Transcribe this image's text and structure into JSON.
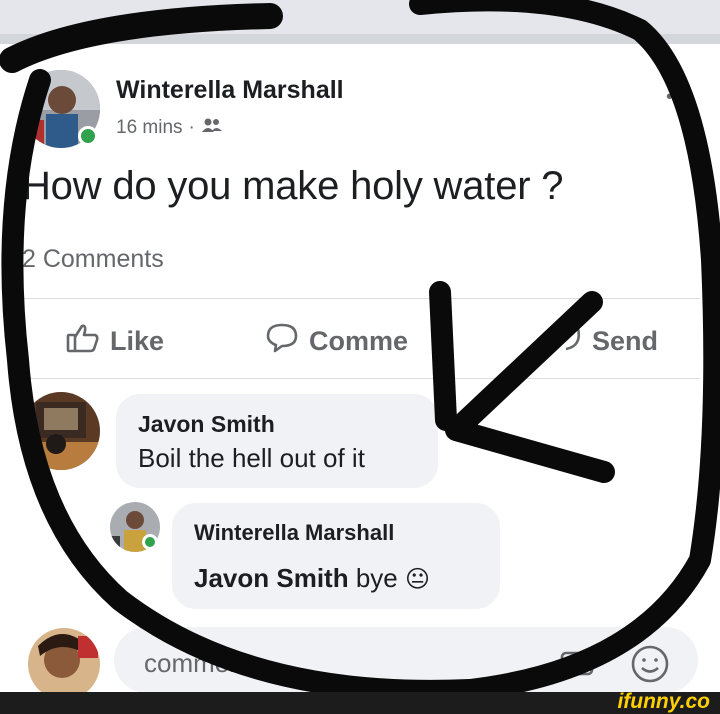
{
  "post": {
    "author": "Winterella Marshall",
    "time": "16 mins",
    "separator": "·",
    "audience_icon": "friends-icon",
    "more_icon": "more-dots-icon",
    "text": "How do you make holy water ?",
    "comments_count": "2 Comments"
  },
  "actions": [
    {
      "label": "Like",
      "icon": "thumbs-up-icon"
    },
    {
      "label": "Comment",
      "visible_label": "Comme",
      "icon": "comment-icon"
    },
    {
      "label": "Send",
      "icon": "send-icon"
    }
  ],
  "comments": [
    {
      "name": "Javon Smith",
      "text": "Boil the hell out of it"
    },
    {
      "name": "Winterella Marshall",
      "mention": "Javon Smith",
      "text": "bye",
      "emoji": "😐"
    }
  ],
  "composer": {
    "placeholder": "Write a comment...",
    "visible_placeholder": "comment...",
    "emoji_icon": "smiley-icon",
    "camera_icon": "camera-icon"
  },
  "watermark": "ifunny.co",
  "colors": {
    "accent_online": "#31a24c",
    "text_primary": "#1c1e21",
    "text_secondary": "#65676b",
    "bubble_bg": "#f0f2f5",
    "marker": "#0a0a0a",
    "watermark": "#ffd000"
  }
}
